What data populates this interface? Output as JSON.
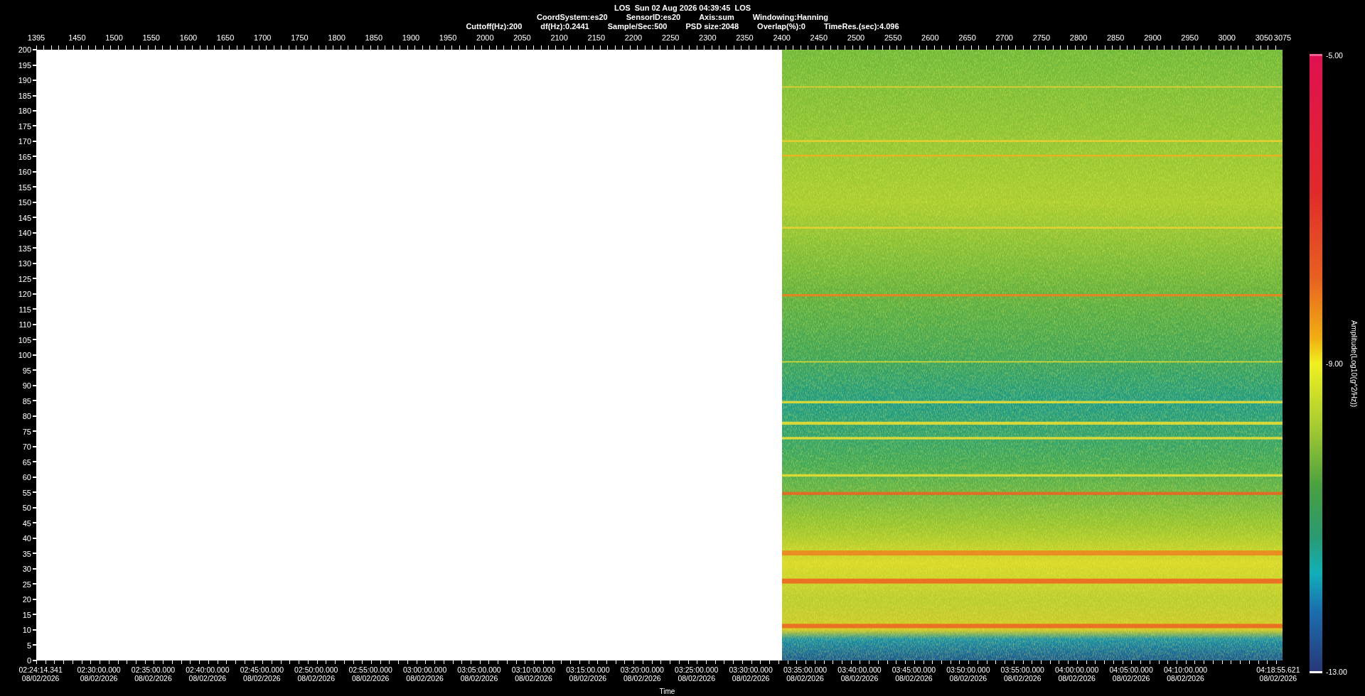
{
  "header": {
    "title": "LOS  Sun 02 Aug 2026 04:39:45  LOS",
    "line_2": [
      "CoordSystem:es20",
      "SensorID:es20",
      "Axis:sum",
      "Windowing:Hanning"
    ],
    "line_3": [
      "Cuttoff(Hz):200",
      "df(Hz):0.2441",
      "Sample/Sec:500",
      "PSD size:2048",
      "Overlap(%):0",
      "TimeRes.(sec):4.096"
    ]
  },
  "top_axis": {
    "ticks": [
      "1395",
      "1450",
      "1500",
      "1550",
      "1600",
      "1650",
      "1700",
      "1750",
      "1800",
      "1850",
      "1900",
      "1950",
      "2000",
      "2050",
      "2100",
      "2150",
      "2200",
      "2250",
      "2300",
      "2350",
      "2400",
      "2450",
      "2500",
      "2550",
      "2600",
      "2650",
      "2700",
      "2750",
      "2800",
      "2850",
      "2900",
      "2950",
      "3000",
      "3050",
      "3075"
    ]
  },
  "left_axis": {
    "ticks": [
      "200",
      "195",
      "190",
      "185",
      "180",
      "175",
      "170",
      "165",
      "160",
      "155",
      "150",
      "145",
      "140",
      "135",
      "130",
      "125",
      "120",
      "115",
      "110",
      "105",
      "100",
      "95",
      "90",
      "85",
      "80",
      "75",
      "70",
      "65",
      "60",
      "55",
      "50",
      "45",
      "40",
      "35",
      "30",
      "25",
      "20",
      "15",
      "10",
      "5",
      "0"
    ]
  },
  "bottom_axis": {
    "title": "Time",
    "ticks": [
      {
        "time": "02:24:14.341",
        "date": "08/02/2026"
      },
      {
        "time": "02:30:00.000",
        "date": "08/02/2026"
      },
      {
        "time": "02:35:00.000",
        "date": "08/02/2026"
      },
      {
        "time": "02:40:00.000",
        "date": "08/02/2026"
      },
      {
        "time": "02:45:00.000",
        "date": "08/02/2026"
      },
      {
        "time": "02:50:00.000",
        "date": "08/02/2026"
      },
      {
        "time": "02:55:00.000",
        "date": "08/02/2026"
      },
      {
        "time": "03:00:00.000",
        "date": "08/02/2026"
      },
      {
        "time": "03:05:00.000",
        "date": "08/02/2026"
      },
      {
        "time": "03:10:00.000",
        "date": "08/02/2026"
      },
      {
        "time": "03:15:00.000",
        "date": "08/02/2026"
      },
      {
        "time": "03:20:00.000",
        "date": "08/02/2026"
      },
      {
        "time": "03:25:00.000",
        "date": "08/02/2026"
      },
      {
        "time": "03:30:00.000",
        "date": "08/02/2026"
      },
      {
        "time": "03:35:00.000",
        "date": "08/02/2026"
      },
      {
        "time": "03:40:00.000",
        "date": "08/02/2026"
      },
      {
        "time": "03:45:00.000",
        "date": "08/02/2026"
      },
      {
        "time": "03:50:00.000",
        "date": "08/02/2026"
      },
      {
        "time": "03:55:00.000",
        "date": "08/02/2026"
      },
      {
        "time": "04:00:00.000",
        "date": "08/02/2026"
      },
      {
        "time": "04:05:00.000",
        "date": "08/02/2026"
      },
      {
        "time": "04:10:00.000",
        "date": "08/02/2026"
      },
      {
        "time": "04:18:55.621",
        "date": "08/02/2026"
      }
    ]
  },
  "colorbar": {
    "title": "Amplitude(Log10(g^2/Hz))",
    "max": "-5.00",
    "mid": "-9.00",
    "min": "-13.00"
  }
}
